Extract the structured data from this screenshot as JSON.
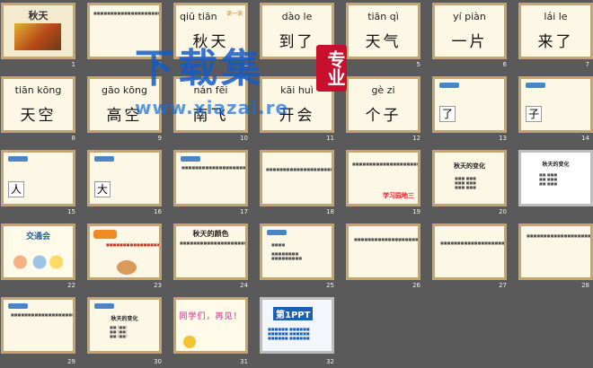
{
  "slides": [
    {
      "n": "1",
      "title": "秋天"
    },
    {
      "n": "2"
    },
    {
      "n": "3",
      "pinyin": "qiū tiān",
      "hanzi": "秋天",
      "badge": "读一读"
    },
    {
      "n": "4",
      "pinyin": "dào le",
      "hanzi": "到了"
    },
    {
      "n": "5",
      "pinyin": "tiān qì",
      "hanzi": "天气"
    },
    {
      "n": "6",
      "pinyin": "yí piàn",
      "hanzi": "一片"
    },
    {
      "n": "7",
      "pinyin": "lái le",
      "hanzi": "来了"
    },
    {
      "n": "8",
      "pinyin": "tiān kōng",
      "hanzi": "天空"
    },
    {
      "n": "9",
      "pinyin": "gāo kōng",
      "hanzi": "高空"
    },
    {
      "n": "10",
      "pinyin": "nán fēi",
      "hanzi": "南飞"
    },
    {
      "n": "11",
      "pinyin": "kāi huì",
      "hanzi": "开会"
    },
    {
      "n": "12",
      "pinyin": "gè zi",
      "hanzi": "个子"
    },
    {
      "n": "13",
      "char": "了"
    },
    {
      "n": "14",
      "char": "子"
    },
    {
      "n": "15",
      "char": "人"
    },
    {
      "n": "16",
      "char": "大"
    },
    {
      "n": "17"
    },
    {
      "n": "18"
    },
    {
      "n": "19",
      "label": "学习园地三"
    },
    {
      "n": "20",
      "title": "秋天的变化"
    },
    {
      "n": "22",
      "title": "交通会"
    },
    {
      "n": "23"
    },
    {
      "n": "24",
      "title": "秋天的颜色"
    },
    {
      "n": "25"
    },
    {
      "n": "26"
    },
    {
      "n": "27"
    },
    {
      "n": "28"
    },
    {
      "n": "29"
    },
    {
      "n": "30",
      "title": "秋天的变化"
    },
    {
      "n": "31",
      "title": "同学们，再见！"
    },
    {
      "n": "32",
      "title": "第1PPT"
    }
  ],
  "watermark": {
    "main": "下载集",
    "sub": "专业",
    "url": "www.xiazai.re"
  }
}
